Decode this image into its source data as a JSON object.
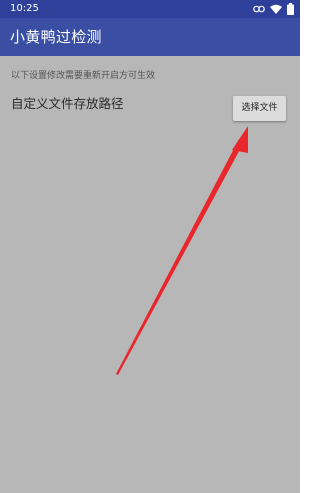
{
  "status_bar": {
    "time": "10:25",
    "icons": [
      "link-icon",
      "wifi-icon",
      "battery-icon"
    ]
  },
  "app_bar": {
    "title": "小黄鸭过检测"
  },
  "settings": {
    "hint": "以下设置修改需要重新开启方可生效",
    "items": [
      {
        "label": "自定义文件存放路径",
        "button_label": "选择文件"
      }
    ]
  },
  "colors": {
    "status_bar": "#2f409a",
    "app_bar": "#3a4ea3",
    "background": "#b7b7b7",
    "annotation_arrow": "#e8262c"
  }
}
